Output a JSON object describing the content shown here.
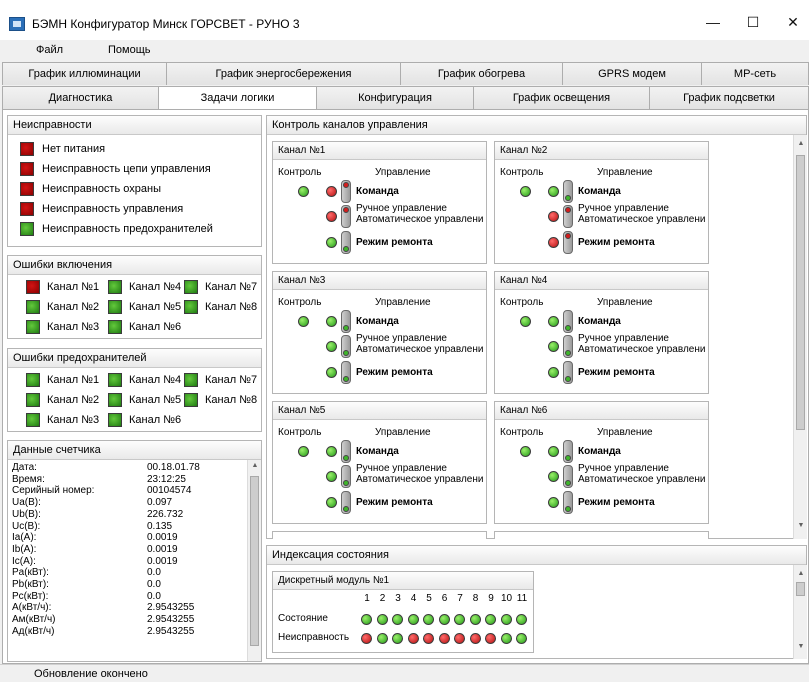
{
  "window": {
    "title": "БЭМН Конфигуратор Минск ГОРСВЕТ - РУНО 3",
    "minimize": "—",
    "maximize": "☐",
    "close": "✕"
  },
  "menu": [
    "Файл",
    "Помощь"
  ],
  "tabs_row1": [
    "График иллюминации",
    "График энергосбережения",
    "График обогрева",
    "GPRS модем",
    "МР-сеть"
  ],
  "tabs_row2": [
    "Диагностика",
    "Задачи логики",
    "Конфигурация",
    "График освещения",
    "График подсветки"
  ],
  "faults": {
    "title": "Неисправности",
    "items": [
      {
        "label": "Нет питания",
        "state": "red"
      },
      {
        "label": "Неисправность цепи управления",
        "state": "red"
      },
      {
        "label": "Неисправность охраны",
        "state": "red"
      },
      {
        "label": "Неисправность управления",
        "state": "red"
      },
      {
        "label": "Неисправность предохранителей",
        "state": "green"
      }
    ]
  },
  "enable_errors": {
    "title": "Ошибки включения",
    "items": [
      {
        "label": "Канал №1",
        "state": "red"
      },
      {
        "label": "Канал №4",
        "state": "green"
      },
      {
        "label": "Канал №7",
        "state": "green"
      },
      {
        "label": "Канал №2",
        "state": "green"
      },
      {
        "label": "Канал №5",
        "state": "green"
      },
      {
        "label": "Канал №8",
        "state": "green"
      },
      {
        "label": "Канал №3",
        "state": "green"
      },
      {
        "label": "Канал №6",
        "state": "green"
      }
    ]
  },
  "fuse_errors": {
    "title": "Ошибки предохранителей",
    "items": [
      {
        "label": "Канал №1",
        "state": "green"
      },
      {
        "label": "Канал №4",
        "state": "green"
      },
      {
        "label": "Канал №7",
        "state": "green"
      },
      {
        "label": "Канал №2",
        "state": "green"
      },
      {
        "label": "Канал №5",
        "state": "green"
      },
      {
        "label": "Канал №8",
        "state": "green"
      },
      {
        "label": "Канал №3",
        "state": "green"
      },
      {
        "label": "Канал №6",
        "state": "green"
      }
    ]
  },
  "meter": {
    "title": "Данные счетчика",
    "rows": [
      {
        "k": "Дата:",
        "v": "00.18.01.78"
      },
      {
        "k": "Время:",
        "v": "23:12:25"
      },
      {
        "k": "Серийный номер:",
        "v": "00104574"
      },
      {
        "k": "Ua(В):",
        "v": "0.097"
      },
      {
        "k": "Ub(В):",
        "v": "226.732"
      },
      {
        "k": "Uc(В):",
        "v": "0.135"
      },
      {
        "k": "Ia(A):",
        "v": "0.0019"
      },
      {
        "k": "Ib(A):",
        "v": "0.0019"
      },
      {
        "k": "Ic(A):",
        "v": "0.0019"
      },
      {
        "k": "Pa(кВт):",
        "v": "0.0"
      },
      {
        "k": "Pb(кВт):",
        "v": "0.0"
      },
      {
        "k": "Pc(кВт):",
        "v": "0.0"
      },
      {
        "k": "А(кВт/ч):",
        "v": "2.9543255"
      },
      {
        "k": "Ам(кВт/ч)",
        "v": "2.9543255"
      },
      {
        "k": "Ад(кВт/ч)",
        "v": "2.9543255"
      }
    ]
  },
  "control": {
    "title": "Контроль каналов управления",
    "col_control": "Контроль",
    "col_manage": "Управление",
    "label_command": "Команда",
    "label_manual": "Ручное управление",
    "label_auto": "Автоматическое управлени",
    "label_repair": "Режим ремонта",
    "channels": [
      {
        "name": "Канал №1",
        "control": "green",
        "cmd_led": "red",
        "cmd_sw": "on",
        "mode_led": "red",
        "mode_sw": "on",
        "repair_led": "green",
        "repair_sw": "off"
      },
      {
        "name": "Канал №2",
        "control": "green",
        "cmd_led": "green",
        "cmd_sw": "off",
        "mode_led": "red",
        "mode_sw": "on",
        "repair_led": "red",
        "repair_sw": "on"
      },
      {
        "name": "Канал №3",
        "control": "green",
        "cmd_led": "green",
        "cmd_sw": "off",
        "mode_led": "green",
        "mode_sw": "off",
        "repair_led": "green",
        "repair_sw": "off"
      },
      {
        "name": "Канал №4",
        "control": "green",
        "cmd_led": "green",
        "cmd_sw": "off",
        "mode_led": "green",
        "mode_sw": "off",
        "repair_led": "green",
        "repair_sw": "off"
      },
      {
        "name": "Канал №5",
        "control": "green",
        "cmd_led": "green",
        "cmd_sw": "off",
        "mode_led": "green",
        "mode_sw": "off",
        "repair_led": "green",
        "repair_sw": "off"
      },
      {
        "name": "Канал №6",
        "control": "green",
        "cmd_led": "green",
        "cmd_sw": "off",
        "mode_led": "green",
        "mode_sw": "off",
        "repair_led": "green",
        "repair_sw": "off"
      }
    ]
  },
  "indication": {
    "title": "Индексация состояния",
    "module": "Дискретный модуль №1",
    "numbers": [
      "1",
      "2",
      "3",
      "4",
      "5",
      "6",
      "7",
      "8",
      "9",
      "10",
      "11"
    ],
    "state_label": "Состояние",
    "fault_label": "Неисправность",
    "state": [
      "green",
      "green",
      "green",
      "green",
      "green",
      "green",
      "green",
      "green",
      "green",
      "green",
      "green"
    ],
    "fault": [
      "red",
      "green",
      "green",
      "red",
      "red",
      "red",
      "red",
      "red",
      "red",
      "green",
      "green"
    ]
  },
  "status": "Обновление окончено",
  "colors": {
    "red": "#c81414",
    "green": "#2fa81c"
  }
}
